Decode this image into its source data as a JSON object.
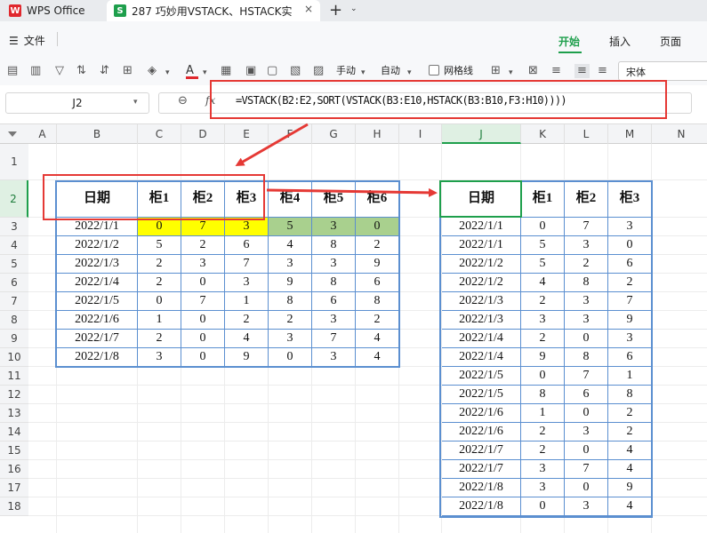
{
  "titlebar": {
    "app_name": "WPS Office",
    "doc_tab": "287 巧妙用VSTACK、HSTACK实",
    "close": "×",
    "new_tab": "+",
    "new_tab_chevron": "⌄"
  },
  "menubar": {
    "file": "文件",
    "tabs": [
      "开始",
      "插入",
      "页面"
    ]
  },
  "toolbar": {
    "manual": "手动",
    "auto": "自动",
    "gridlines": "网格线",
    "font": "宋体"
  },
  "formulabar": {
    "namebox": "J2",
    "fx": "fx",
    "formula": "=VSTACK(B2:E2,SORT(VSTACK(B3:E10,HSTACK(B3:B10,F3:H10))))"
  },
  "columns": [
    "A",
    "B",
    "C",
    "D",
    "E",
    "F",
    "G",
    "H",
    "I",
    "J",
    "K",
    "L",
    "M",
    "N"
  ],
  "selected_column": "J",
  "rows": [
    "1",
    "2",
    "3",
    "4",
    "5",
    "6",
    "7",
    "8",
    "9",
    "10",
    "11",
    "12",
    "13",
    "14",
    "15",
    "16",
    "17",
    "18"
  ],
  "selected_row": "2",
  "source_table": {
    "headers": [
      "日期",
      "柜1",
      "柜2",
      "柜3",
      "柜4",
      "柜5",
      "柜6"
    ],
    "rows": [
      [
        "2022/1/1",
        "0",
        "7",
        "3",
        "5",
        "3",
        "0"
      ],
      [
        "2022/1/2",
        "5",
        "2",
        "6",
        "4",
        "8",
        "2"
      ],
      [
        "2022/1/3",
        "2",
        "3",
        "7",
        "3",
        "3",
        "9"
      ],
      [
        "2022/1/4",
        "2",
        "0",
        "3",
        "9",
        "8",
        "6"
      ],
      [
        "2022/1/5",
        "0",
        "7",
        "1",
        "8",
        "6",
        "8"
      ],
      [
        "2022/1/6",
        "1",
        "0",
        "2",
        "2",
        "3",
        "2"
      ],
      [
        "2022/1/7",
        "2",
        "0",
        "4",
        "3",
        "7",
        "4"
      ],
      [
        "2022/1/8",
        "3",
        "0",
        "9",
        "0",
        "3",
        "4"
      ]
    ],
    "highlight_colors": {
      "yellow": "#ffff00",
      "green": "#a9d08e"
    }
  },
  "result_table": {
    "headers": [
      "日期",
      "柜1",
      "柜2",
      "柜3"
    ],
    "rows": [
      [
        "2022/1/1",
        "0",
        "7",
        "3"
      ],
      [
        "2022/1/1",
        "5",
        "3",
        "0"
      ],
      [
        "2022/1/2",
        "5",
        "2",
        "6"
      ],
      [
        "2022/1/2",
        "4",
        "8",
        "2"
      ],
      [
        "2022/1/3",
        "2",
        "3",
        "7"
      ],
      [
        "2022/1/3",
        "3",
        "3",
        "9"
      ],
      [
        "2022/1/4",
        "2",
        "0",
        "3"
      ],
      [
        "2022/1/4",
        "9",
        "8",
        "6"
      ],
      [
        "2022/1/5",
        "0",
        "7",
        "1"
      ],
      [
        "2022/1/5",
        "8",
        "6",
        "8"
      ],
      [
        "2022/1/6",
        "1",
        "0",
        "2"
      ],
      [
        "2022/1/6",
        "2",
        "3",
        "2"
      ],
      [
        "2022/1/7",
        "2",
        "0",
        "4"
      ],
      [
        "2022/1/7",
        "3",
        "7",
        "4"
      ],
      [
        "2022/1/8",
        "3",
        "0",
        "9"
      ],
      [
        "2022/1/8",
        "0",
        "3",
        "4"
      ]
    ]
  },
  "colors": {
    "accent": "#1e9f4c",
    "annotation": "#e53935",
    "table_border": "#5b8fd0"
  }
}
